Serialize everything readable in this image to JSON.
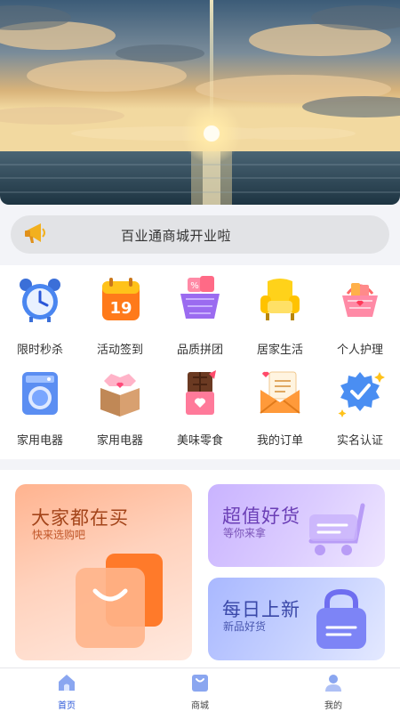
{
  "notice": {
    "text": "百业通商城开业啦",
    "icon": "megaphone-icon"
  },
  "categories": [
    {
      "label": "限时秒杀",
      "icon": "alarm-clock-icon"
    },
    {
      "label": "活动签到",
      "icon": "calendar-icon"
    },
    {
      "label": "品质拼团",
      "icon": "shopping-basket-icon"
    },
    {
      "label": "居家生活",
      "icon": "armchair-icon"
    },
    {
      "label": "个人护理",
      "icon": "care-basket-icon"
    },
    {
      "label": "家用电器",
      "icon": "washing-machine-icon"
    },
    {
      "label": "家用电器",
      "icon": "clothes-box-icon"
    },
    {
      "label": "美味零食",
      "icon": "chocolate-icon"
    },
    {
      "label": "我的订单",
      "icon": "envelope-icon"
    },
    {
      "label": "实名认证",
      "icon": "verified-badge-icon"
    }
  ],
  "promos": {
    "big": {
      "title": "大家都在买",
      "subtitle": "快来选购吧"
    },
    "right_top": {
      "title": "超值好货",
      "subtitle": "等你来拿"
    },
    "right_bottom": {
      "title": "每日上新",
      "subtitle": "新品好货"
    }
  },
  "tabbar": [
    {
      "label": "首页",
      "icon": "home-icon",
      "active": true
    },
    {
      "label": "商城",
      "icon": "store-icon",
      "active": false
    },
    {
      "label": "我的",
      "icon": "user-icon",
      "active": false
    }
  ],
  "colors": {
    "accent": "#2a56d8",
    "notice_bg": "#e2e3e6"
  }
}
